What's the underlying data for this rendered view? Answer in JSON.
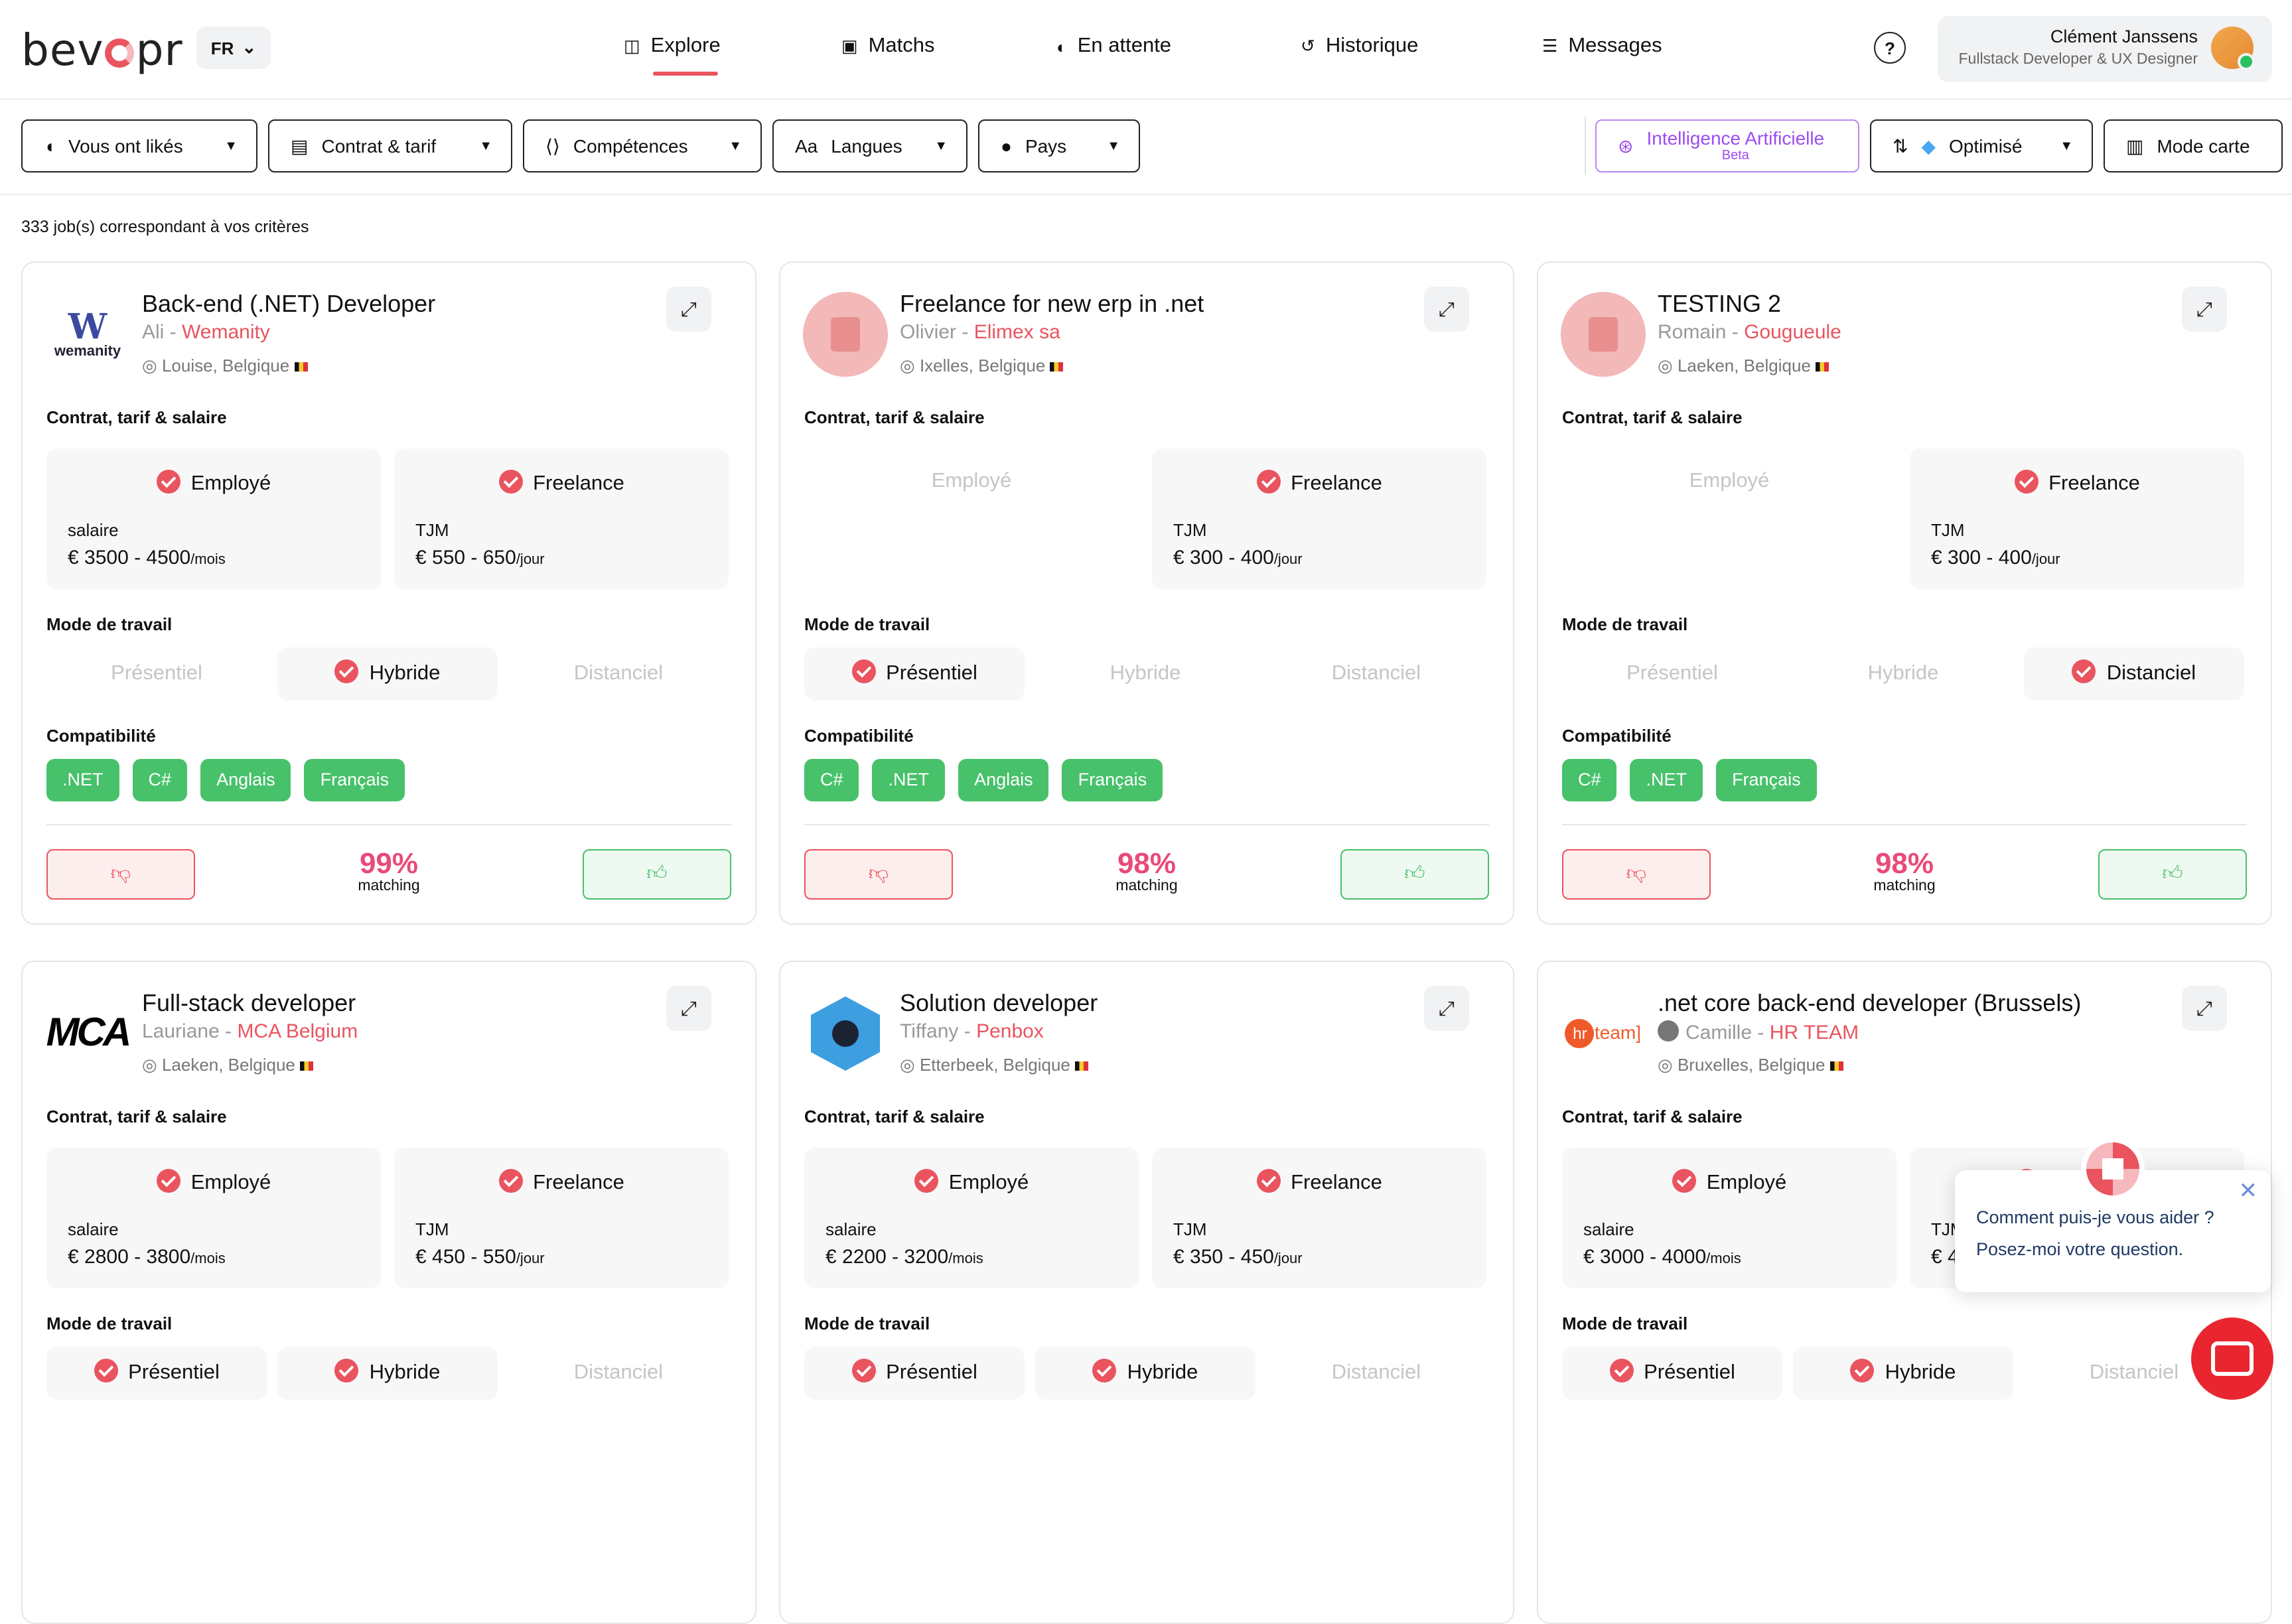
{
  "header": {
    "logo_text": "bevopr",
    "lang": "FR",
    "nav": [
      {
        "label": "Explore",
        "icon": "explore-icon",
        "glyph": "◫",
        "active": true
      },
      {
        "label": "Matchs",
        "icon": "matchs-icon",
        "glyph": "▣",
        "active": false
      },
      {
        "label": "En attente",
        "icon": "waiting-icon",
        "glyph": "◐",
        "active": false
      },
      {
        "label": "Historique",
        "icon": "history-icon",
        "glyph": "↺",
        "active": false
      },
      {
        "label": "Messages",
        "icon": "messages-icon",
        "glyph": "☰",
        "active": false
      }
    ],
    "help": "?",
    "user": {
      "name": "Clément Janssens",
      "role": "Fullstack Developer & UX Designer"
    }
  },
  "filters": {
    "liked": "Vous ont likés",
    "contract": "Contrat & tarif",
    "skills": "Compétences",
    "languages": "Langues",
    "country": "Pays",
    "ai_title": "Intelligence Artificielle",
    "ai_badge": "Beta",
    "sort": "Optimisé",
    "map": "Mode carte"
  },
  "results_count": "333 job(s) correspondant à vos critères",
  "labels": {
    "contract_section": "Contrat, tarif & salaire",
    "work_mode_section": "Mode de travail",
    "compat_section": "Compatibilité",
    "employee": "Employé",
    "freelance": "Freelance",
    "salary": "salaire",
    "tjm": "TJM",
    "per_month": "/mois",
    "per_day": "/jour",
    "onsite": "Présentiel",
    "hybrid": "Hybride",
    "remote": "Distanciel",
    "matching": "matching"
  },
  "jobs": [
    {
      "title": "Back-end (.NET) Developer",
      "person": "Ali",
      "company": "Wemanity",
      "location": "Louise, Belgique",
      "logo": "wemanity",
      "employee": true,
      "salary": "€ 3500 - 4500",
      "freelance": true,
      "tjm": "€ 550 - 650",
      "modes": {
        "onsite": false,
        "hybrid": true,
        "remote": false
      },
      "tags": [
        ".NET",
        "C#",
        "Anglais",
        "Français"
      ],
      "match": "99%"
    },
    {
      "title": "Freelance for new erp in .net",
      "person": "Olivier",
      "company": "Elimex sa",
      "location": "Ixelles, Belgique",
      "logo": "building",
      "employee": false,
      "salary": "",
      "freelance": true,
      "tjm": "€ 300 - 400",
      "modes": {
        "onsite": true,
        "hybrid": false,
        "remote": false
      },
      "tags": [
        "C#",
        ".NET",
        "Anglais",
        "Français"
      ],
      "match": "98%"
    },
    {
      "title": "TESTING 2",
      "person": "Romain",
      "company": "Gougueule",
      "location": "Laeken, Belgique",
      "logo": "building",
      "employee": false,
      "salary": "",
      "freelance": true,
      "tjm": "€ 300 - 400",
      "modes": {
        "onsite": false,
        "hybrid": false,
        "remote": true
      },
      "tags": [
        "C#",
        ".NET",
        "Français"
      ],
      "match": "98%"
    },
    {
      "title": "Full-stack developer",
      "person": "Lauriane",
      "company": "MCA Belgium",
      "location": "Laeken, Belgique",
      "logo": "mca",
      "employee": true,
      "salary": "€ 2800 - 3800",
      "freelance": true,
      "tjm": "€ 450 - 550",
      "modes": {
        "onsite": true,
        "hybrid": true,
        "remote": false
      },
      "tags": [],
      "match": ""
    },
    {
      "title": "Solution developer",
      "person": "Tiffany",
      "company": "Penbox",
      "location": "Etterbeek, Belgique",
      "logo": "hex",
      "employee": true,
      "salary": "€ 2200 - 3200",
      "freelance": true,
      "tjm": "€ 350 - 450",
      "modes": {
        "onsite": true,
        "hybrid": true,
        "remote": false
      },
      "tags": [],
      "match": ""
    },
    {
      "title": ".net core back-end developer (Brussels)",
      "person": "Camille",
      "company": "HR TEAM",
      "location": "Bruxelles, Belgique",
      "logo": "hrteam",
      "employee": true,
      "salary": "€ 3000 - 4000",
      "freelance": true,
      "tjm": "€ 4",
      "modes": {
        "onsite": true,
        "hybrid": true,
        "remote": false
      },
      "tags": [],
      "match": ""
    }
  ],
  "chat": {
    "line1": "Comment puis-je vous aider ?",
    "line2": "Posez-moi votre question."
  },
  "colors": {
    "accent": "#e9545f",
    "green": "#48c16b",
    "match": "#e94a7a",
    "ai": "#9b4df0"
  }
}
